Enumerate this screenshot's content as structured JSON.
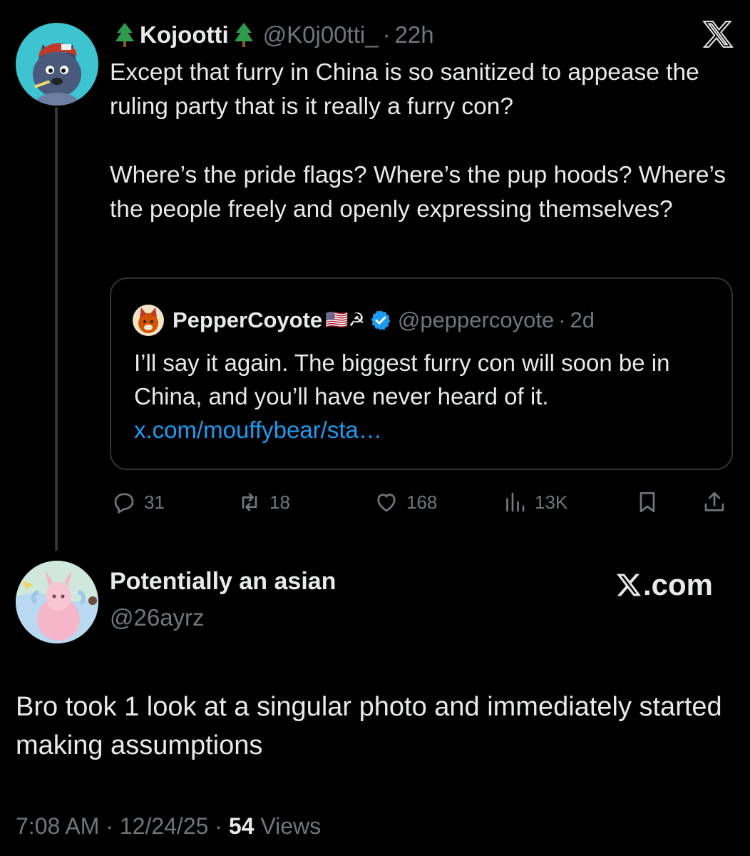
{
  "tweet": {
    "name": "Kojootti",
    "handle": "@K0j00tti_",
    "separator": "·",
    "time": "22h",
    "text": "Except that furry in China is so sanitized to appease the ruling party that is it really a furry con?\n\nWhere’s the pride flags? Where’s the pup hoods? Where’s the people freely and openly expressing themselves?",
    "logo_icon": "x-logo-icon"
  },
  "quote": {
    "name": "PepperCoyote",
    "emoji": "🇺🇸☭",
    "verified_icon": "verified-badge-icon",
    "handle": "@peppercoyote",
    "separator": "·",
    "time": "2d",
    "text": "I’ll say it again. The biggest furry con will soon be in China, and you’ll have never heard of it.",
    "link": "x.com/mouffybear/sta…"
  },
  "actions": {
    "replies": "31",
    "reposts": "18",
    "likes": "168",
    "views": "13K"
  },
  "reply": {
    "name": "Potentially an asian",
    "handle": "@26ayrz",
    "brand": ".com",
    "text": "Bro took 1 look at a singular photo and immediately started making assumptions",
    "time": "7:08 AM",
    "separator": "·",
    "date": "12/24/25",
    "views_count": "54",
    "views_label": "Views"
  },
  "colors": {
    "background": "#000000",
    "text": "#e7e9ea",
    "muted": "#71767b",
    "link": "#1d9bf0",
    "border": "#2f3336"
  }
}
